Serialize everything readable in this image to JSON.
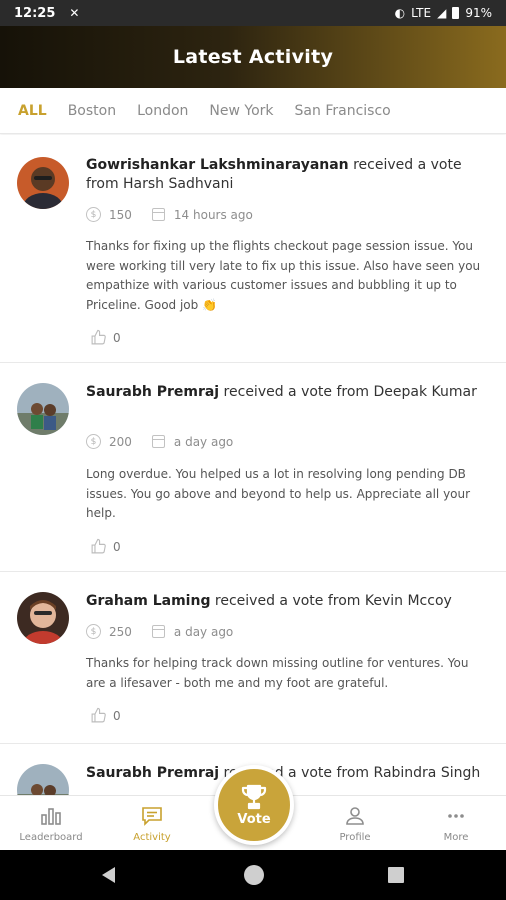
{
  "status_bar": {
    "time": "12:25",
    "network": "LTE",
    "battery": "91%"
  },
  "header": {
    "title": "Latest Activity"
  },
  "tabs": [
    {
      "label": "ALL",
      "active": true
    },
    {
      "label": "Boston",
      "active": false
    },
    {
      "label": "London",
      "active": false
    },
    {
      "label": "New York",
      "active": false
    },
    {
      "label": "San Francisco",
      "active": false
    }
  ],
  "feed": [
    {
      "recipient": "Gowrishankar Lakshminarayanan",
      "action": " received a vote from Harsh Sadhvani",
      "points": "150",
      "time": "14 hours ago",
      "message": "Thanks for fixing up the flights checkout page session issue. You were working till very late to fix up this issue. Also have seen you empathize with various customer issues and bubbling it up to Priceline. Good job 👏",
      "likes": "0"
    },
    {
      "recipient": "Saurabh Premraj",
      "action": " received a vote from Deepak Kumar",
      "points": "200",
      "time": "a day ago",
      "message": "Long overdue. You helped us a lot in resolving long pending DB issues. You go above and beyond to help us. Appreciate all your help.",
      "likes": "0"
    },
    {
      "recipient": "Graham Laming",
      "action": " received a vote from Kevin Mccoy",
      "points": "250",
      "time": "a day ago",
      "message": "Thanks for helping track down missing outline for ventures. You are a lifesaver - both me and my foot are grateful.",
      "likes": "0"
    },
    {
      "recipient": "Saurabh Premraj",
      "action": " received a vote from Rabindra Singh",
      "points": "",
      "time": "",
      "message": "",
      "likes": ""
    }
  ],
  "bottom_nav": {
    "leaderboard": "Leaderboard",
    "activity": "Activity",
    "vote": "Vote",
    "profile": "Profile",
    "more": "More"
  },
  "colors": {
    "accent": "#c8a12e",
    "header_dark": "#161208",
    "header_gold": "#8a6b1e"
  },
  "icons": [
    "coin-icon",
    "calendar-icon",
    "thumbs-up-icon",
    "bar-chart-icon",
    "chat-icon",
    "trophy-icon",
    "person-icon",
    "ellipsis-icon"
  ]
}
